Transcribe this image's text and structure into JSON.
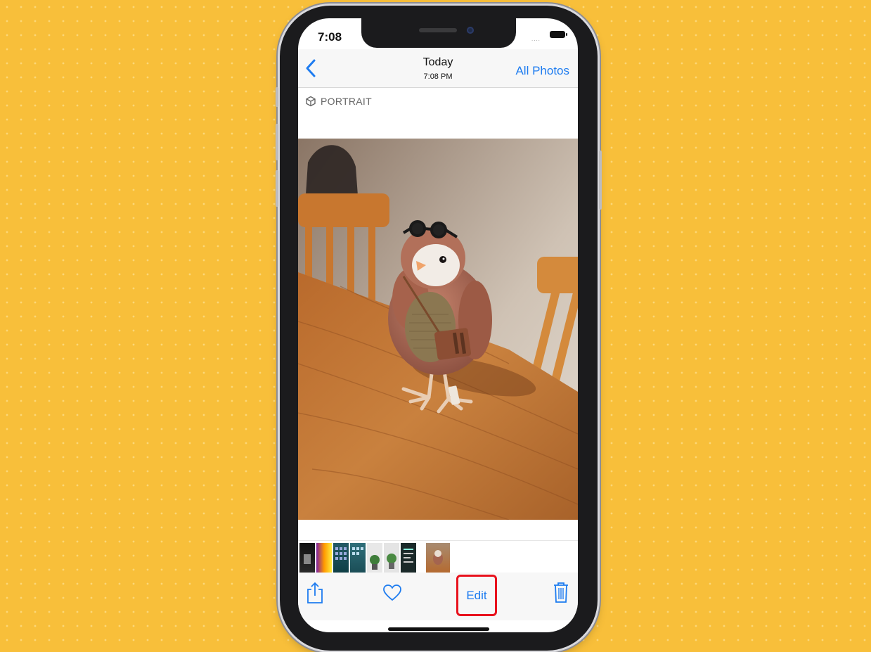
{
  "status_bar": {
    "time": "7:08",
    "signal_dots": "...."
  },
  "nav": {
    "back_icon": "chevron-left-icon",
    "title": "Today",
    "subtitle": "7:08 PM",
    "all_photos_label": "All Photos"
  },
  "photo": {
    "badge_icon": "cube-icon",
    "badge_label": "PORTRAIT"
  },
  "filmstrip": {
    "thumbnail_count": 8,
    "selected_index": 7
  },
  "toolbar": {
    "share_icon": "share-icon",
    "favorite_icon": "heart-icon",
    "edit_label": "Edit",
    "delete_icon": "trash-icon"
  },
  "colors": {
    "background": "#f8bf3a",
    "accent": "#1e7cf0",
    "highlight": "#e8121d"
  }
}
